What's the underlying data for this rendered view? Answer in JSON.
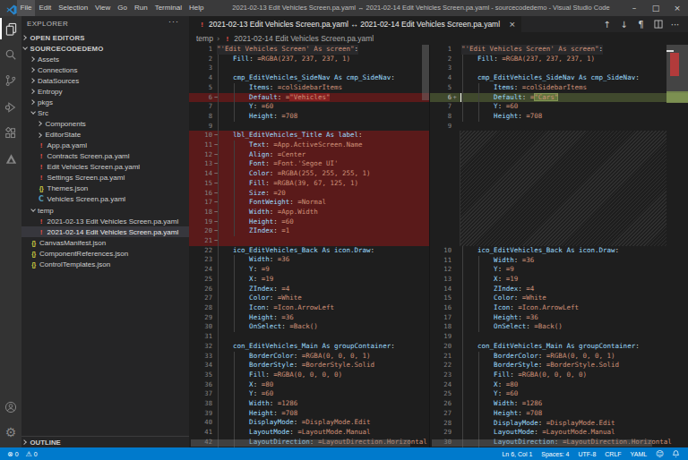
{
  "window": {
    "title": "2021-02-13 Edit Vehicles Screen.pa.yaml ↔ 2021-02-14 Edit Vehicles Screen.pa.yaml - sourcecodedemo - Visual Studio Code",
    "menu": [
      "File",
      "Edit",
      "Selection",
      "View",
      "Go",
      "Run",
      "Terminal",
      "Help"
    ],
    "controls": [
      {
        "id": "minimize",
        "glyph": "–"
      },
      {
        "id": "maximize",
        "glyph": "□"
      },
      {
        "id": "close",
        "glyph": "×"
      }
    ]
  },
  "activity_bar": {
    "top": [
      {
        "id": "explorer",
        "active": true
      },
      {
        "id": "search",
        "active": false
      },
      {
        "id": "source-control",
        "active": false
      },
      {
        "id": "run-debug",
        "active": false
      },
      {
        "id": "extensions",
        "active": false
      },
      {
        "id": "power-platform",
        "active": false
      }
    ],
    "bottom": [
      {
        "id": "account",
        "active": false
      },
      {
        "id": "settings",
        "active": false
      }
    ]
  },
  "sidebar": {
    "header": "EXPLORER",
    "more_glyph": "···",
    "open_editors": "OPEN EDITORS",
    "outline": "OUTLINE",
    "tree": [
      {
        "label": "SOURCECODEDEMO",
        "level": 0,
        "type": "section",
        "expanded": true
      },
      {
        "label": "Assets",
        "level": 1,
        "type": "folder"
      },
      {
        "label": "Connections",
        "level": 1,
        "type": "folder"
      },
      {
        "label": "DataSources",
        "level": 1,
        "type": "folder"
      },
      {
        "label": "Entropy",
        "level": 1,
        "type": "folder"
      },
      {
        "label": "pkgs",
        "level": 1,
        "type": "folder"
      },
      {
        "label": "Src",
        "level": 1,
        "type": "folder",
        "expanded": true
      },
      {
        "label": "Components",
        "level": 2,
        "type": "folder"
      },
      {
        "label": "EditorState",
        "level": 2,
        "type": "folder"
      },
      {
        "label": "App.pa.yaml",
        "level": 2,
        "type": "yaml"
      },
      {
        "label": "Contracts Screen.pa.yaml",
        "level": 2,
        "type": "yaml"
      },
      {
        "label": "Edit Vehicles Screen.pa.yaml",
        "level": 2,
        "type": "yaml"
      },
      {
        "label": "Settings Screen.pa.yaml",
        "level": 2,
        "type": "yaml"
      },
      {
        "label": "Themes.json",
        "level": 2,
        "type": "json"
      },
      {
        "label": "Vehicles Screen.pa.yaml",
        "level": 2,
        "type": "vehicles"
      },
      {
        "label": "temp",
        "level": 1,
        "type": "folder",
        "expanded": true
      },
      {
        "label": "2021-02-13 Edit Vehicles Screen.pa.yaml",
        "level": 2,
        "type": "yaml"
      },
      {
        "label": "2021-02-14 Edit Vehicles Screen.pa.yaml",
        "level": 2,
        "type": "yaml",
        "selected": true
      },
      {
        "label": "CanvasManifest.json",
        "level": 1,
        "type": "json"
      },
      {
        "label": "ComponentReferences.json",
        "level": 1,
        "type": "json"
      },
      {
        "label": "ControlTemplates.json",
        "level": 1,
        "type": "json"
      }
    ]
  },
  "icons": {
    "yaml": "!",
    "json": "{}",
    "vehicles": "C"
  },
  "editor": {
    "tab": {
      "icon": "yaml",
      "label": "2021-02-13 Edit Vehicles Screen.pa.yaml ↔ 2021-02-14 Edit Vehicles Screen.pa.yaml",
      "close_glyph": "×"
    },
    "actions": [
      {
        "id": "previous-change",
        "glyph": "↑"
      },
      {
        "id": "next-change",
        "glyph": "↓"
      },
      {
        "id": "whitespace-toggle",
        "glyph": "¶"
      },
      {
        "id": "split-editor",
        "glyph": "svg-split"
      },
      {
        "id": "more-actions",
        "glyph": "···"
      }
    ],
    "breadcrumb": {
      "folder": "temp",
      "separator": "›",
      "file_icon": "yaml",
      "file": "2021-02-14 Edit Vehicles Screen.pa.yaml"
    }
  },
  "diff": {
    "left": {
      "lines": [
        {
          "n": 1,
          "k": "\"'Edit Vehicles Screen' As screen\"",
          "kc": "sk",
          "t1": true
        },
        {
          "n": 2,
          "k": "    Fill",
          "v": "=RGBA(237, 237, 237, 1)"
        },
        {
          "n": 3
        },
        {
          "n": 4,
          "k": "    cmp_EditVehicles_SideNav As cmp_SideNav"
        },
        {
          "n": 5,
          "k": "        Items",
          "v": "=colSidebarItems"
        },
        {
          "n": 6,
          "k": "        Default",
          "vp": "=",
          "vb": "\"Vehicles\"",
          "m": "−",
          "c": "rm"
        },
        {
          "n": 7,
          "k": "        Y",
          "v": "=60"
        },
        {
          "n": 8,
          "k": "        Height",
          "v": "=708"
        },
        {
          "n": 9
        },
        {
          "n": 10,
          "k": "    lbl_EditVehicles_Title As label",
          "m": "−",
          "c": "rm"
        },
        {
          "n": 11,
          "k": "        Text",
          "v": "=App.ActiveScreen.Name",
          "m": "−",
          "c": "rm"
        },
        {
          "n": 12,
          "k": "        Align",
          "v": "=Center",
          "m": "−",
          "c": "rm"
        },
        {
          "n": 13,
          "k": "        Font",
          "v": "=Font.'Segoe UI'",
          "m": "−",
          "c": "rm"
        },
        {
          "n": 14,
          "k": "        Color",
          "v": "=RGBA(255, 255, 255, 1)",
          "m": "−",
          "c": "rm"
        },
        {
          "n": 15,
          "k": "        Fill",
          "v": "=RGBA(39, 67, 125, 1)",
          "m": "−",
          "c": "rm"
        },
        {
          "n": 16,
          "k": "        Size",
          "v": "=20",
          "m": "−",
          "c": "rm"
        },
        {
          "n": 17,
          "k": "        FontWeight",
          "v": "=Normal",
          "m": "−",
          "c": "rm"
        },
        {
          "n": 18,
          "k": "        Width",
          "v": "=App.Width",
          "m": "−",
          "c": "rm"
        },
        {
          "n": 19,
          "k": "        Height",
          "v": "=60",
          "m": "−",
          "c": "rm"
        },
        {
          "n": 20,
          "k": "        ZIndex",
          "v": "=1",
          "m": "−",
          "c": "rm"
        },
        {
          "n": 21,
          "m": "−",
          "c": "rm"
        },
        {
          "n": 22,
          "k": "    ico_EditVehicles_Back As icon.Draw"
        },
        {
          "n": 23,
          "k": "        Width",
          "v": "=36"
        },
        {
          "n": 24,
          "k": "        Y",
          "v": "=9"
        },
        {
          "n": 25,
          "k": "        X",
          "v": "=19"
        },
        {
          "n": 26,
          "k": "        ZIndex",
          "v": "=4"
        },
        {
          "n": 27,
          "k": "        Color",
          "v": "=White"
        },
        {
          "n": 28,
          "k": "        Icon",
          "v": "=Icon.ArrowLeft"
        },
        {
          "n": 29,
          "k": "        Height",
          "v": "=36"
        },
        {
          "n": 30,
          "k": "        OnSelect",
          "v": "=Back()"
        },
        {
          "n": 31
        },
        {
          "n": 32,
          "k": "    con_EditVehicles_Main As groupContainer"
        },
        {
          "n": 33,
          "k": "        BorderColor",
          "v": "=RGBA(0, 0, 0, 1)"
        },
        {
          "n": 34,
          "k": "        BorderStyle",
          "v": "=BorderStyle.Solid"
        },
        {
          "n": 35,
          "k": "        Fill",
          "v": "=RGBA(0, 0, 0, 0)"
        },
        {
          "n": 36,
          "k": "        X",
          "v": "=80"
        },
        {
          "n": 37,
          "k": "        Y",
          "v": "=60"
        },
        {
          "n": 38,
          "k": "        Width",
          "v": "=1286"
        },
        {
          "n": 39,
          "k": "        Height",
          "v": "=708"
        },
        {
          "n": 40,
          "k": "        DisplayMode",
          "v": "=DisplayMode.Edit"
        },
        {
          "n": 41,
          "k": "        LayoutMode",
          "v": "=LayoutMode.Manual"
        },
        {
          "n": 42,
          "k": "        LayoutDirection",
          "v": "=LayoutDirection.Horizontal"
        }
      ]
    },
    "right": {
      "lines": [
        {
          "n": 1,
          "k": "\"'Edit Vehicles Screen' As screen\"",
          "kc": "sk",
          "t1": true
        },
        {
          "n": 2,
          "k": "    Fill",
          "v": "=RGBA(237, 237, 237, 1)"
        },
        {
          "n": 3
        },
        {
          "n": 4,
          "k": "    cmp_EditVehicles_SideNav As cmp_SideNav"
        },
        {
          "n": 5,
          "k": "        Items",
          "v": "=colSidebarItems"
        },
        {
          "n": 6,
          "k": "        Default",
          "vp": "=",
          "vb": "\"Cars\"",
          "m": "+",
          "c": "add",
          "cursor": true
        },
        {
          "n": 7,
          "k": "        Y",
          "v": "=60"
        },
        {
          "n": 8,
          "k": "        Height",
          "v": "=708"
        },
        {
          "n": 9
        },
        {
          "hatch": 12
        },
        {
          "n": 10,
          "k": "    ico_EditVehicles_Back As icon.Draw"
        },
        {
          "n": 11,
          "k": "        Width",
          "v": "=36"
        },
        {
          "n": 12,
          "k": "        Y",
          "v": "=9"
        },
        {
          "n": 13,
          "k": "        X",
          "v": "=19"
        },
        {
          "n": 14,
          "k": "        ZIndex",
          "v": "=4"
        },
        {
          "n": 15,
          "k": "        Color",
          "v": "=White"
        },
        {
          "n": 16,
          "k": "        Icon",
          "v": "=Icon.ArrowLeft"
        },
        {
          "n": 17,
          "k": "        Height",
          "v": "=36"
        },
        {
          "n": 18,
          "k": "        OnSelect",
          "v": "=Back()"
        },
        {
          "n": 19
        },
        {
          "n": 20,
          "k": "    con_EditVehicles_Main As groupContainer"
        },
        {
          "n": 21,
          "k": "        BorderColor",
          "v": "=RGBA(0, 0, 0, 1)"
        },
        {
          "n": 22,
          "k": "        BorderStyle",
          "v": "=BorderStyle.Solid"
        },
        {
          "n": 23,
          "k": "        Fill",
          "v": "=RGBA(0, 0, 0, 0)"
        },
        {
          "n": 24,
          "k": "        X",
          "v": "=80"
        },
        {
          "n": 25,
          "k": "        Y",
          "v": "=60"
        },
        {
          "n": 26,
          "k": "        Width",
          "v": "=1286"
        },
        {
          "n": 27,
          "k": "        Height",
          "v": "=708"
        },
        {
          "n": 28,
          "k": "        DisplayMode",
          "v": "=DisplayMode.Edit"
        },
        {
          "n": 29,
          "k": "        LayoutMode",
          "v": "=LayoutMode.Manual"
        },
        {
          "n": 30,
          "k": "        LayoutDirection",
          "v": "=LayoutDirection.Horizontal"
        }
      ]
    }
  },
  "status_bar": {
    "left": [
      {
        "icon": "error",
        "glyph": "⊗",
        "value": "0"
      },
      {
        "icon": "warning",
        "glyph": "⚠",
        "value": "0"
      }
    ],
    "right": [
      "Ln 6, Col 1",
      "Spaces: 4",
      "UTF-8",
      "CRLF",
      "YAML"
    ],
    "right_icons": [
      {
        "id": "feedback",
        "glyph": "☺"
      },
      {
        "id": "bell",
        "glyph": "svg-bell"
      }
    ]
  },
  "colors": {
    "status_bar": "#007acc",
    "removed_line": "rgba(255,20,20,0.27)",
    "added_line": "rgba(155,185,85,0.28)",
    "key": "#9cdcfe",
    "value": "#ce9178"
  }
}
